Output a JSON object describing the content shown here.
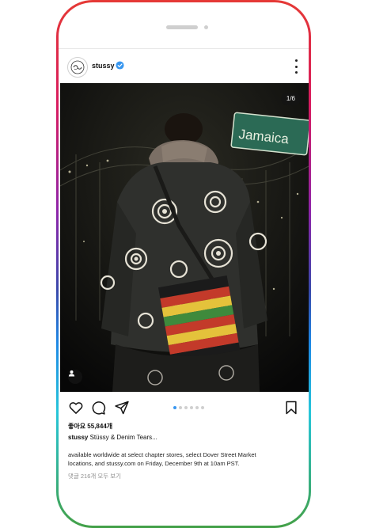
{
  "post": {
    "username": "stussy",
    "avatar_icon": "stussy-logo-icon",
    "verified_icon": "verified-badge-icon",
    "more_icon": "more-options-icon",
    "photo_counter": "1/6",
    "photo_sign_text": "Jamaica",
    "likes": "좋아요 55,844개",
    "caption_user": "stussy",
    "caption_text": "Stüssy & Denim Tears...",
    "body_line1": "available worldwide at select chapter stores, select Dover Street Market",
    "body_line2": "locations, and stussy.com on Friday, December 9th at 10am PST.",
    "view_comments": "댓글 216개 모두 보기",
    "carousel_total": 6,
    "carousel_active": 1
  },
  "actions": {
    "like_icon": "heart-icon",
    "comment_icon": "comment-icon",
    "share_icon": "send-icon",
    "save_icon": "bookmark-icon"
  },
  "colors": {
    "frame_gradient": [
      "#e53935",
      "#8e24aa",
      "#1e88e5",
      "#43a047"
    ],
    "accent_dot": "#3897f0",
    "verified": "#3897f0"
  }
}
